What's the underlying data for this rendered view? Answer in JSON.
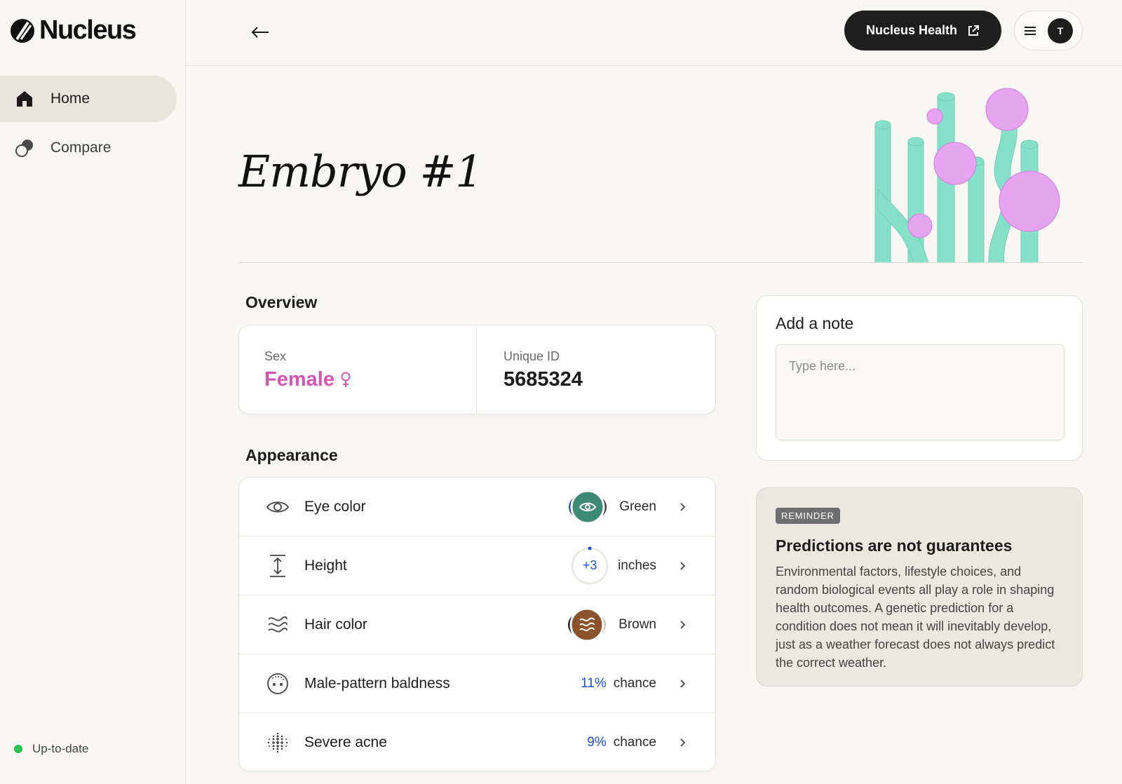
{
  "brand": {
    "name": "Nucleus"
  },
  "sidebar": {
    "items": [
      {
        "label": "Home",
        "icon": "home-icon",
        "active": true
      },
      {
        "label": "Compare",
        "icon": "compare-icon",
        "active": false
      }
    ],
    "status": {
      "label": "Up-to-date",
      "color": "#2fbf56"
    }
  },
  "topbar": {
    "cta_label": "Nucleus Health",
    "avatar_initial": "T"
  },
  "page": {
    "title": "Embryo #1"
  },
  "overview": {
    "title": "Overview",
    "sex": {
      "label": "Sex",
      "value": "Female",
      "color": "#d455b5"
    },
    "unique_id": {
      "label": "Unique ID",
      "value": "5685324"
    }
  },
  "appearance": {
    "title": "Appearance",
    "traits": [
      {
        "label": "Eye color",
        "icon": "eye-icon",
        "value": "Green",
        "swatch": "#3f8a74"
      },
      {
        "label": "Height",
        "icon": "height-icon",
        "value": "+3",
        "unit": "inches"
      },
      {
        "label": "Hair color",
        "icon": "waves-icon",
        "value": "Brown",
        "swatch": "#8a532c"
      },
      {
        "label": "Male-pattern baldness",
        "icon": "head-dots-icon",
        "value": "11%",
        "unit": "chance"
      },
      {
        "label": "Severe acne",
        "icon": "dot-grid-icon",
        "value": "9%",
        "unit": "chance"
      }
    ]
  },
  "note": {
    "title": "Add a note",
    "placeholder": "Type here..."
  },
  "reminder": {
    "badge": "REMINDER",
    "title": "Predictions are not guarantees",
    "body": "Environmental factors, lifestyle choices, and random biological events all play a role in shaping health outcomes. A genetic prediction for a condition does not mean it will inevitably develop, just as a weather forecast does not always predict the correct weather."
  },
  "colors": {
    "accent_blue": "#1d4fd1",
    "female_pink": "#d455b5",
    "background": "#f9f7f3"
  }
}
